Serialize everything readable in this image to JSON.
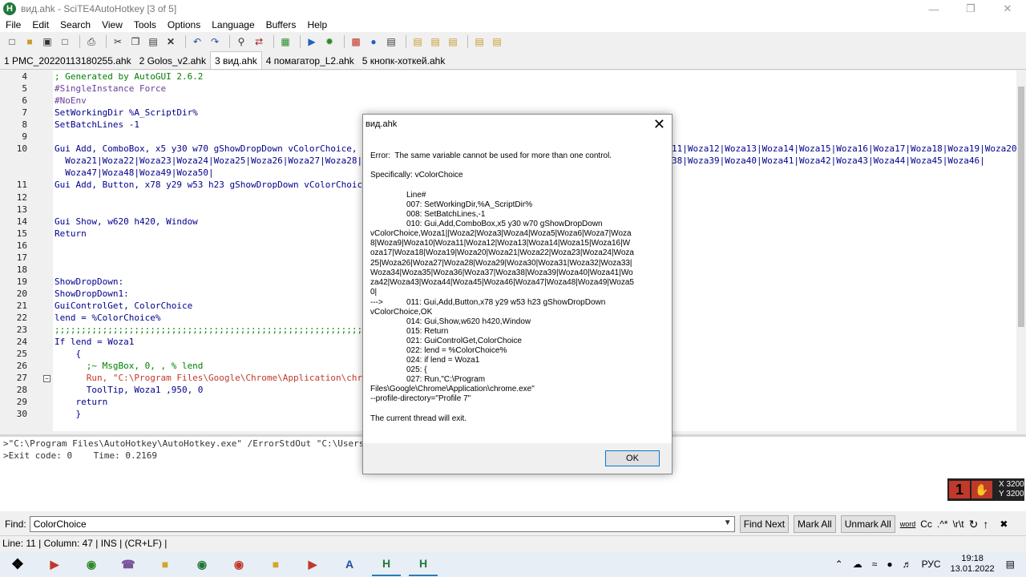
{
  "window": {
    "title": "вид.ahk - SciTE4AutoHotkey [3 of 5]",
    "app_icon_letter": "H"
  },
  "menu": [
    "File",
    "Edit",
    "Search",
    "View",
    "Tools",
    "Options",
    "Language",
    "Buffers",
    "Help"
  ],
  "tabs": [
    {
      "label": "1 PMC_20220113180255.ahk",
      "active": false
    },
    {
      "label": "2 Golos_v2.ahk",
      "active": false
    },
    {
      "label": "3 вид.ahk",
      "active": true
    },
    {
      "label": "4 помагатор_L2.ahk",
      "active": false
    },
    {
      "label": "5 кнопк-хоткей.ahk",
      "active": false
    }
  ],
  "editor": {
    "line_numbers": [
      "4",
      "5",
      "6",
      "7",
      "8",
      "9",
      "10",
      "",
      "",
      "11",
      "12",
      "13",
      "14",
      "15",
      "16",
      "17",
      "18",
      "19",
      "20",
      "21",
      "22",
      "23",
      "24",
      "25",
      "26",
      "27",
      "28",
      "29",
      "30"
    ],
    "lines": [
      "; Generated by AutoGUI 2.6.2",
      "#SingleInstance Force",
      "#NoEnv",
      "SetWorkingDir %A_ScriptDir%",
      "SetBatchLines -1",
      "",
      "Gui Add, ComboBox, x5 y30 w70 gShowDropDown vColorChoice, Woza",
      "  Woza21|Woza22|Woza23|Woza24|Woza25|Woza26|Woza27|Woza28|",
      "  Woza47|Woza48|Woza49|Woza50|",
      "Gui Add, Button, x78 y29 w53 h23 gShowDropDown vColorChoice, OK",
      "",
      "",
      "Gui Show, w620 h420, Window",
      "Return",
      "",
      "",
      "",
      "ShowDropDown:",
      "ShowDropDown1:",
      "GuiControlGet, ColorChoice",
      "lend = %ColorChoice%",
      ";;;;;;;;;;;;;;;;;;;;;;;;;;;;;;;;;;;;;;;;;;;;;;;;;;;;;;;;;;;;;;;;;;;;;;;;",
      "If lend = Woza1",
      "    {",
      "      ;~ MsgBox, 0, , % lend",
      "      Run, \"C:\\Program Files\\Google\\Chrome\\Application\\chrome.exe\"",
      "      ToolTip, Woza1 ,950, 0",
      "    return",
      "    }"
    ],
    "line10_tail": "11|Woza12|Woza13|Woza14|Woza15|Woza16|Woza17|Woza18|Woza19|Woza20|",
    "line10b_tail": "38|Woza39|Woza40|Woza41|Woza42|Woza43|Woza44|Woza45|Woza46|"
  },
  "output": {
    "lines": [
      ">\"C:\\Program Files\\AutoHotkey\\AutoHotkey.exe\" /ErrorStdOut \"C:\\Users\\wox",
      ">Exit code: 0    Time: 0.2169"
    ]
  },
  "hud": {
    "number": "1",
    "x": "X 3200",
    "y": "Y 3200"
  },
  "find": {
    "label": "Find:",
    "value": "ColorChoice",
    "find_next": "Find Next",
    "mark_all": "Mark All",
    "unmark_all": "Unmark All",
    "opt_word": "word",
    "opt_case": "Cc",
    "opt_regex": ".^*",
    "opt_escape": "\\r\\t"
  },
  "status": "Line: 11 | Column: 47 | INS | (CR+LF) |",
  "taskbar": {
    "lang": "РУС",
    "time": "19:18",
    "date": "13.01.2022"
  },
  "dialog": {
    "title": "вид.ahk",
    "error": "Error:  The same variable cannot be used for more than one control.",
    "specifically": "Specifically: vColorChoice",
    "line_header": "Line#",
    "l007": "007: SetWorkingDir,%A_ScriptDir%",
    "l008": "008: SetBatchLines,-1",
    "l010": "010: Gui,Add,ComboBox,x5 y30 w70 gShowDropDown",
    "wrap": "vColorChoice,Woza1||Woza2|Woza3|Woza4|Woza5|Woza6|Woza7|Woza\n8|Woza9|Woza10|Woza11|Woza12|Woza13|Woza14|Woza15|Woza16|W\noza17|Woza18|Woza19|Woza20|Woza21|Woza22|Woza23|Woza24|Woza\n25|Woza26|Woza27|Woza28|Woza29|Woza30|Woza31|Woza32|Woza33|\nWoza34|Woza35|Woza36|Woza37|Woza38|Woza39|Woza40|Woza41|Wo\nza42|Woza43|Woza44|Woza45|Woza46|Woza47|Woza48|Woza49|Woza5\n0|",
    "arrow": "--->",
    "l011": "011: Gui,Add,Button,x78 y29 w53 h23 gShowDropDown",
    "l011b": "vColorChoice,OK",
    "l014": "014: Gui,Show,w620 h420,Window",
    "l015": "015: Return",
    "l021": "021: GuiControlGet,ColorChoice",
    "l022": "022: lend = %ColorChoice%",
    "l024": "024: if lend = Woza1",
    "l025": "025: {",
    "l027": "027: Run,\"C:\\Program",
    "l027b": "Files\\Google\\Chrome\\Application\\chrome.exe\"",
    "l027c": "--profile-directory=\"Profile 7\"",
    "thread": "The current thread will exit.",
    "ok": "OK"
  }
}
